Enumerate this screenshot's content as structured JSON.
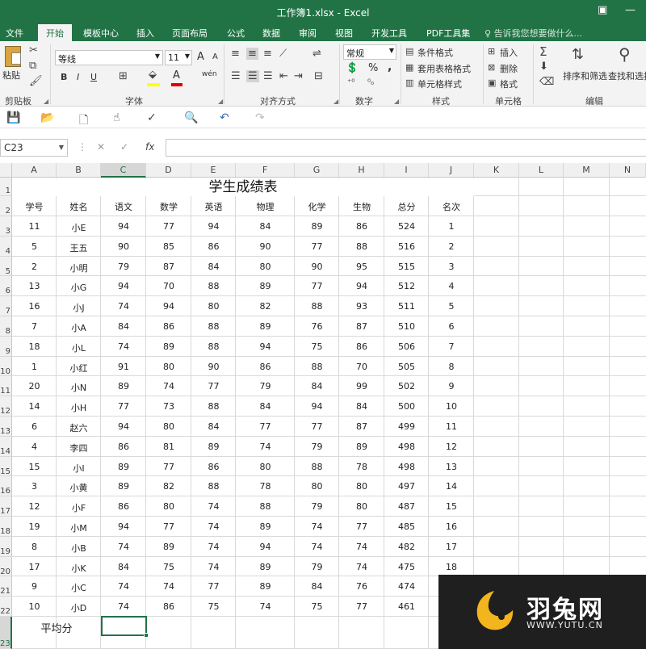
{
  "window": {
    "title": "工作簿1.xlsx - Excel",
    "restore_glyph": "▣",
    "minimize_glyph": "—"
  },
  "ribbon_tabs": [
    "文件",
    "开始",
    "模板中心",
    "插入",
    "页面布局",
    "公式",
    "数据",
    "审阅",
    "视图",
    "开发工具",
    "PDF工具集"
  ],
  "active_tab": "开始",
  "tell_me": "告诉我您想要做什么...",
  "clipboard": {
    "paste_label": "粘贴",
    "group_label": "剪贴板"
  },
  "font": {
    "name": "等线",
    "size": "11",
    "bold": "B",
    "italic": "I",
    "underline": "U",
    "grow": "A",
    "shrink": "A",
    "font_color_glyph": "A",
    "wen_label": "wén",
    "group_label": "字体",
    "fill_color": "#ffff00",
    "font_color": "#e00000"
  },
  "alignment": {
    "group_label": "对齐方式"
  },
  "number": {
    "format": "常规",
    "percent": "%",
    "comma": ",",
    "group_label": "数字"
  },
  "styles": {
    "conditional": "条件格式",
    "table_format": "套用表格格式",
    "cell_styles": "单元格样式",
    "group_label": "样式"
  },
  "cells": {
    "insert": "插入",
    "delete": "删除",
    "format": "格式",
    "group_label": "单元格"
  },
  "editing": {
    "sort": "排序和筛选",
    "find": "查找和选择",
    "group_label": "编辑"
  },
  "formula_bar": {
    "name_box": "C23",
    "cancel": "✕",
    "enter": "✓",
    "fx": "fx",
    "value": ""
  },
  "columns": [
    "A",
    "B",
    "C",
    "D",
    "E",
    "F",
    "G",
    "H",
    "I",
    "J",
    "K",
    "L",
    "M",
    "N"
  ],
  "selected_column": "C",
  "selected_row": 23,
  "sheet": {
    "title": "学生成绩表",
    "headers": [
      "学号",
      "姓名",
      "语文",
      "数学",
      "英语",
      "物理",
      "化学",
      "生物",
      "总分",
      "名次"
    ],
    "rows": [
      [
        "11",
        "小E",
        "94",
        "77",
        "94",
        "84",
        "89",
        "86",
        "524",
        "1"
      ],
      [
        "5",
        "王五",
        "90",
        "85",
        "86",
        "90",
        "77",
        "88",
        "516",
        "2"
      ],
      [
        "2",
        "小明",
        "79",
        "87",
        "84",
        "80",
        "90",
        "95",
        "515",
        "3"
      ],
      [
        "13",
        "小G",
        "94",
        "70",
        "88",
        "89",
        "77",
        "94",
        "512",
        "4"
      ],
      [
        "16",
        "小J",
        "74",
        "94",
        "80",
        "82",
        "88",
        "93",
        "511",
        "5"
      ],
      [
        "7",
        "小A",
        "84",
        "86",
        "88",
        "89",
        "76",
        "87",
        "510",
        "6"
      ],
      [
        "18",
        "小L",
        "74",
        "89",
        "88",
        "94",
        "75",
        "86",
        "506",
        "7"
      ],
      [
        "1",
        "小红",
        "91",
        "80",
        "90",
        "86",
        "88",
        "70",
        "505",
        "8"
      ],
      [
        "20",
        "小N",
        "89",
        "74",
        "77",
        "79",
        "84",
        "99",
        "502",
        "9"
      ],
      [
        "14",
        "小H",
        "77",
        "73",
        "88",
        "84",
        "94",
        "84",
        "500",
        "10"
      ],
      [
        "6",
        "赵六",
        "94",
        "80",
        "84",
        "77",
        "77",
        "87",
        "499",
        "11"
      ],
      [
        "4",
        "李四",
        "86",
        "81",
        "89",
        "74",
        "79",
        "89",
        "498",
        "12"
      ],
      [
        "15",
        "小I",
        "89",
        "77",
        "86",
        "80",
        "88",
        "78",
        "498",
        "13"
      ],
      [
        "3",
        "小黄",
        "89",
        "82",
        "88",
        "78",
        "80",
        "80",
        "497",
        "14"
      ],
      [
        "12",
        "小F",
        "86",
        "80",
        "74",
        "88",
        "79",
        "80",
        "487",
        "15"
      ],
      [
        "19",
        "小M",
        "94",
        "77",
        "74",
        "89",
        "74",
        "77",
        "485",
        "16"
      ],
      [
        "8",
        "小B",
        "74",
        "89",
        "74",
        "94",
        "74",
        "74",
        "482",
        "17"
      ],
      [
        "17",
        "小K",
        "84",
        "75",
        "74",
        "89",
        "79",
        "74",
        "475",
        "18"
      ],
      [
        "9",
        "小C",
        "74",
        "74",
        "77",
        "89",
        "84",
        "76",
        "474",
        ""
      ],
      [
        "10",
        "小D",
        "74",
        "86",
        "75",
        "74",
        "75",
        "77",
        "461",
        ""
      ]
    ],
    "average_label": "平均分"
  },
  "watermark": {
    "cn": "羽兔网",
    "url": "WWW.YUTU.CN"
  }
}
